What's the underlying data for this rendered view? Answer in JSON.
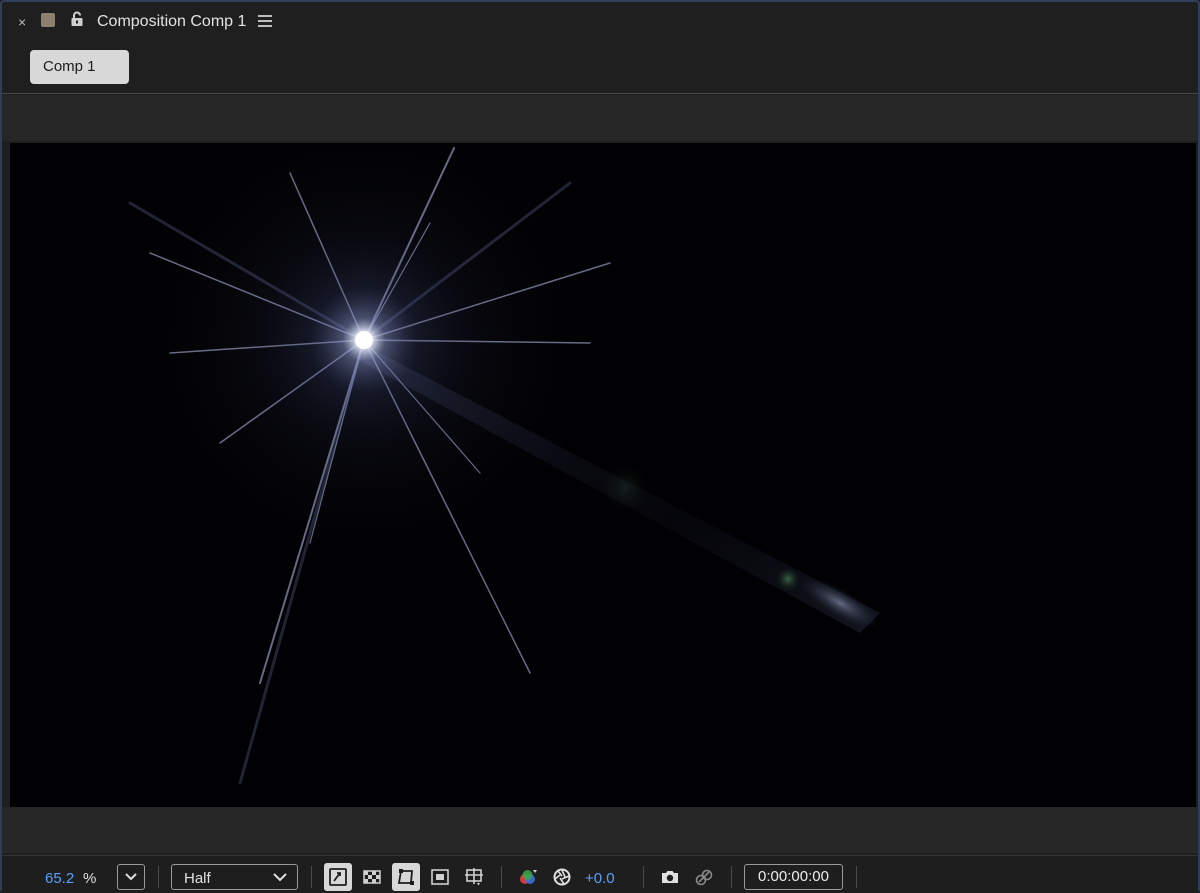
{
  "header": {
    "close_label": "×",
    "title": "Composition Comp 1",
    "icons": {
      "close": "close-icon",
      "label_color": "label-color-swatch",
      "lock": "lock-icon",
      "menu": "hamburger-menu-icon"
    },
    "label_color": "#8c7f6d"
  },
  "tabs": [
    {
      "label": "Comp 1",
      "active": true
    }
  ],
  "toolbar": {
    "zoom_value": "65.2",
    "zoom_unit": "%",
    "resolution": "Half",
    "exposure": "+0.0",
    "timecode": "0:00:00:00",
    "icons": [
      "always-preview-icon",
      "transparency-grid-icon",
      "mask-path-visibility-icon",
      "region-of-interest-icon",
      "grid-guides-icon",
      "show-channel-icon",
      "reset-exposure-icon",
      "snapshot-camera-icon",
      "show-snapshot-icon"
    ],
    "accent_color": "#5aa0ff"
  }
}
